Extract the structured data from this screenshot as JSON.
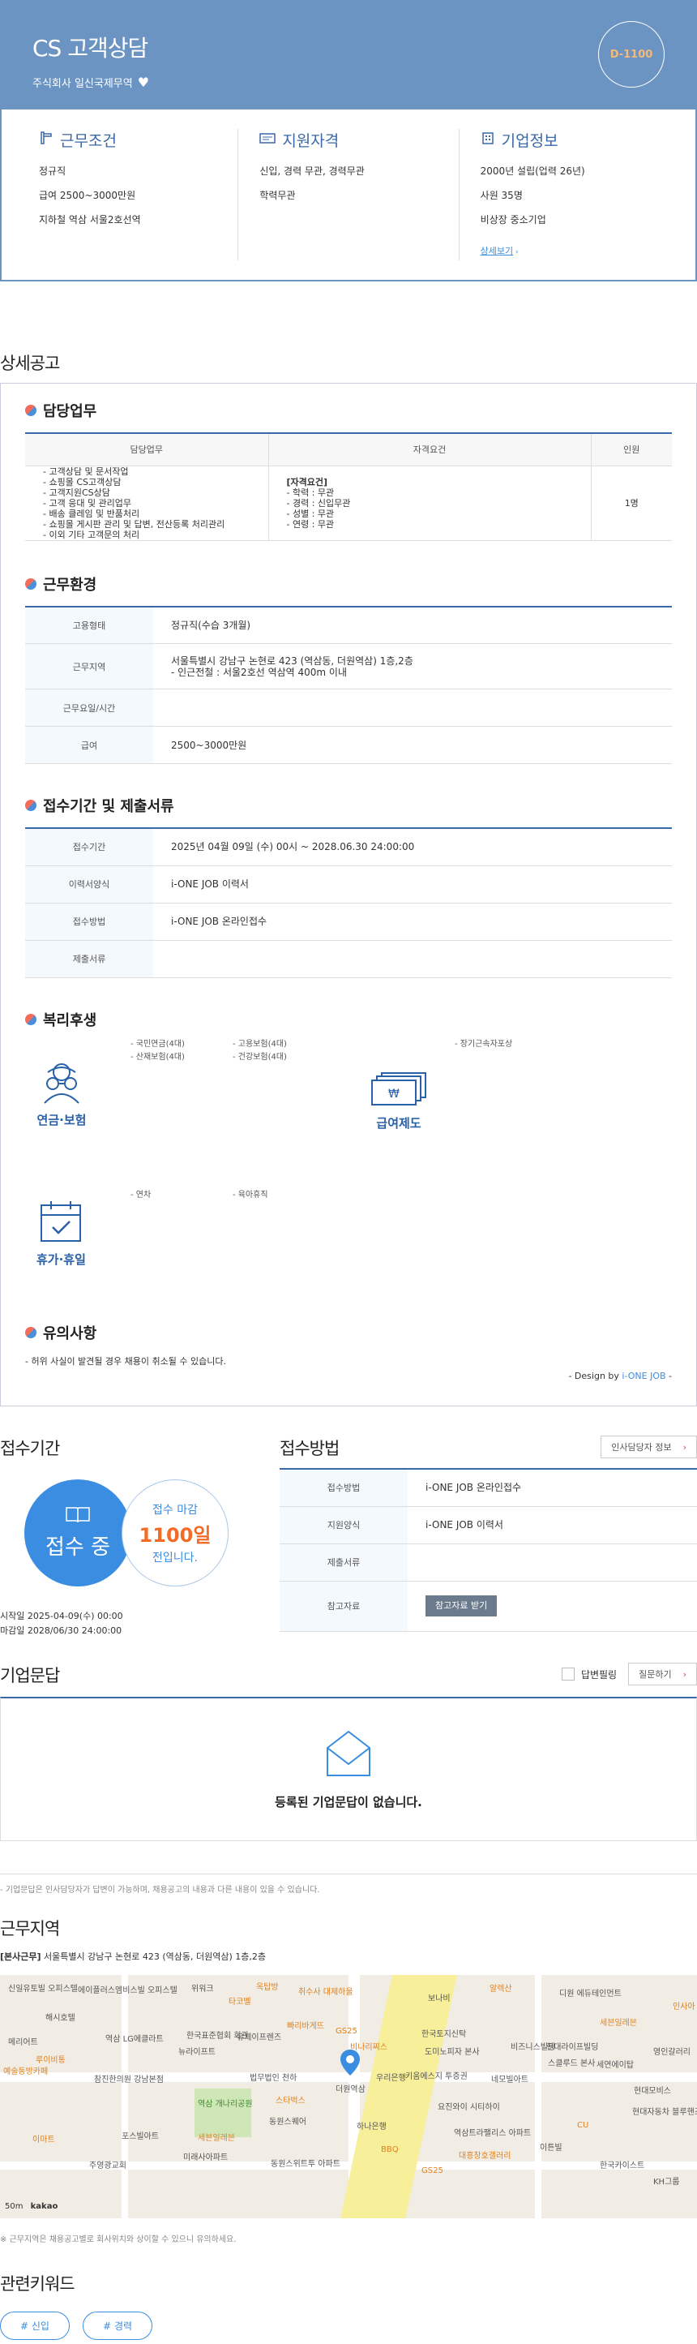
{
  "header": {
    "title": "CS 고객상담",
    "company": "주식회사 일신국제무역",
    "dday": "D-1100"
  },
  "summary": {
    "conditions": {
      "title": "근무조건",
      "items": [
        "정규직",
        "급여 2500~3000만원",
        "지하철 역삼 서울2호선역"
      ]
    },
    "qualification": {
      "title": "지원자격",
      "items": [
        "신입, 경력 무관, 경력무관",
        "학력무관"
      ]
    },
    "company": {
      "title": "기업정보",
      "items": [
        "2000년 설립(업력 26년)",
        "사원 35명",
        "비상장 중소기업"
      ],
      "more": "상세보기"
    }
  },
  "detail": {
    "title": "상세공고",
    "duty": {
      "title": "담당업무",
      "headers": [
        "담당업무",
        "자격요건",
        "인원"
      ],
      "tasks": [
        "- 고객상담 및 문서작업",
        "- 쇼핑몰 CS고객상담",
        "- 고객지원CS상담",
        "- 고객 응대 및 관리업무",
        "- 배송 클레임 및 반품처리",
        "- 쇼핑몰 게시판 관리 및 답변, 전산등록 처리관리",
        "- 이외 기타 고객문의 처리"
      ],
      "req_title": "[자격요건]",
      "reqs": [
        "- 학력 : 무관",
        "- 경력 : 신입무관",
        "- 성별 : 무관",
        "- 연령 : 무관"
      ],
      "count": "1명"
    },
    "env": {
      "title": "근무환경",
      "rows": [
        {
          "k": "고용형태",
          "v": "정규직(수습 3개월)"
        },
        {
          "k": "근무지역",
          "v": "서울특별시 강남구 논현로 423 (역삼동, 더원역삼) 1층,2층",
          "v2": "- 인근전철 : 서울2호선 역삼역 400m 이내"
        },
        {
          "k": "근무요일/시간",
          "v": ""
        },
        {
          "k": "급여",
          "v": "2500~3000만원"
        }
      ]
    },
    "period": {
      "title": "접수기간 및 제출서류",
      "rows": [
        {
          "k": "접수기간",
          "v": "2025년 04월 09일 (수) 00시 ~ 2028.06.30 24:00:00"
        },
        {
          "k": "이력서양식",
          "v": "i-ONE JOB 이력서"
        },
        {
          "k": "접수방법",
          "v": "i-ONE JOB 온라인접수"
        },
        {
          "k": "제출서류",
          "v": ""
        }
      ]
    },
    "welfare": {
      "title": "복리후생",
      "pension": {
        "label": "연금·보험",
        "col1": [
          "- 국민연금(4대)",
          "- 산재보험(4대)"
        ],
        "col2": [
          "- 고용보험(4대)",
          "- 건강보험(4대)"
        ]
      },
      "salary": {
        "label": "급여제도",
        "col1": [
          "- 장기근속자포상"
        ]
      },
      "vacation": {
        "label": "휴가·휴일",
        "col1": [
          "- 연차"
        ],
        "col2": [
          "- 육아휴직"
        ]
      }
    },
    "notes": {
      "title": "유의사항",
      "text": "- 허위 사실이 발견될 경우 채용이 취소될 수 있습니다.",
      "design_prefix": "- Design by ",
      "design_brand": "i-ONE JOB",
      "design_suffix": " -"
    }
  },
  "apply_period": {
    "title": "접수기간",
    "status": "접수 중",
    "deadline_label": "접수 마감",
    "days": "1100일",
    "remain": "전입니다.",
    "start": "시작일 2025-04-09(수) 00:00",
    "end": "마감일 2028/06/30 24:00:00"
  },
  "apply_method": {
    "title": "접수방법",
    "hr_button": "인사담당자 정보",
    "rows": [
      {
        "k": "접수방법",
        "v": "i-ONE JOB 온라인접수"
      },
      {
        "k": "지원양식",
        "v": "i-ONE JOB 이력서"
      },
      {
        "k": "제출서류",
        "v": ""
      },
      {
        "k": "참고자료",
        "v": "참고자료 받기"
      }
    ]
  },
  "qa": {
    "title": "기업문답",
    "checkbox_label": "답변필링",
    "ask_button": "질문하기",
    "empty": "등록된 기업문답이 없습니다.",
    "note": "- 기업문답은 인사담당자가 답변이 가능하며, 채용공고의 내용과 다른 내용이 있을 수 있습니다."
  },
  "location": {
    "title": "근무지역",
    "tag": "[본사근무]",
    "address": "서울특별시 강남구 논현로 423 (역삼동, 더원역삼) 1층,2층",
    "note": "※ 근무지역은 채용공고별로 회사위치와 상이할 수 있으니 유의하세요.",
    "map_scale": "50m",
    "map_brand": "kakao",
    "places": [
      "신일유토빌 오피스텔",
      "에이플러스엠비스빌 오피스텔",
      "위워크",
      "타코벨",
      "옥탑방",
      "취수사 대제하울",
      "보나비",
      "알렉산",
      "디원 에듀테인먼트",
      "인사아",
      "해시호텔",
      "세븐일레븐",
      "메리어트",
      "빠리바게뜨",
      "한국표준협회 회관",
      "뉴라이프트",
      "역삼 LG에클라트",
      "루이비통",
      "유제이프렌즈",
      "GS25",
      "한국토지신탁",
      "도미노피자 본사",
      "비나리찌스",
      "비즈니스빌딩",
      "스클루드 본사",
      "세연에이탑",
      "현대라이프빌딩",
      "영인갈러리",
      "예술동방카페",
      "참진한의원 강남본점",
      "역삼 개나리공원",
      "법무법인 천하",
      "더원역삼",
      "스타벅스",
      "키움에스지 투증권",
      "우리은행",
      "요진와이 시티하이",
      "네모빌아트",
      "현대모비스",
      "하나은행",
      "역삼트라팰리스 아파트",
      "동원스퀘어",
      "CU",
      "포스빌아트",
      "세븐일레븐",
      "GS25",
      "이튼빌",
      "대흥창호갤러리",
      "한국카이스트",
      "주영광교회",
      "미래사아파트",
      "동원스위트투 아파트",
      "BBQ",
      "이마트",
      "KH그룹",
      "현대자동차 블루핸즈"
    ]
  },
  "keywords": {
    "title": "관련키워드",
    "items": [
      "# 신입",
      "# 경력"
    ]
  }
}
